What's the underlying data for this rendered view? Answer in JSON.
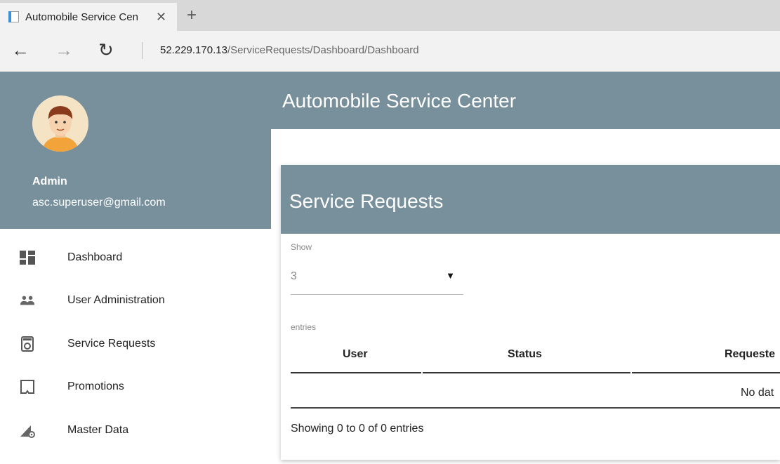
{
  "browser": {
    "tab_title": "Automobile Service Cen",
    "close_glyph": "✕",
    "new_tab_glyph": "+",
    "back_glyph": "←",
    "forward_glyph": "→",
    "refresh_glyph": "↻",
    "url_host": "52.229.170.13",
    "url_path": "/ServiceRequests/Dashboard/Dashboard"
  },
  "header": {
    "title": "Automobile Service Center"
  },
  "sidebar": {
    "user_name": "Admin",
    "user_email": "asc.superuser@gmail.com",
    "items": [
      {
        "label": "Dashboard",
        "icon": "dashboard-icon"
      },
      {
        "label": "User Administration",
        "icon": "users-icon"
      },
      {
        "label": "Service Requests",
        "icon": "service-requests-icon"
      },
      {
        "label": "Promotions",
        "icon": "promotions-icon"
      },
      {
        "label": "Master Data",
        "icon": "master-data-icon"
      }
    ]
  },
  "card": {
    "title": "Service Requests",
    "show_label": "Show",
    "page_size": "3",
    "dropdown_glyph": "▼",
    "entries_label": "entries",
    "columns": [
      "User",
      "Status",
      "Requeste"
    ],
    "empty_message": "No dat",
    "info": "Showing 0 to 0 of 0 entries"
  },
  "colors": {
    "primary": "#78909c",
    "tabbar": "#d8d8d8",
    "toolbar": "#f2f2f2"
  }
}
